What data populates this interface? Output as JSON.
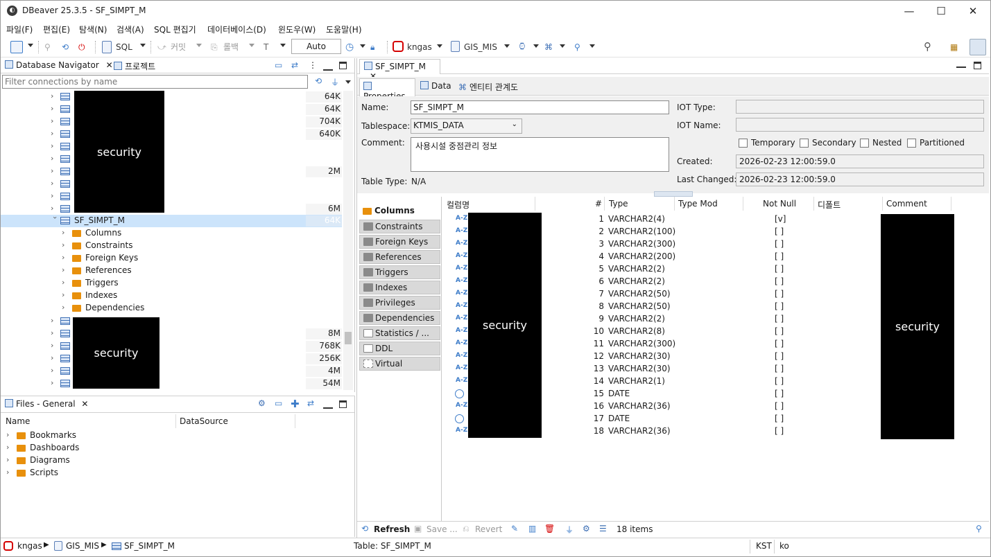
{
  "window": {
    "title": "DBeaver 25.3.5 - SF_SIMPT_M",
    "min": "—",
    "max": "☐",
    "close": "✕"
  },
  "menu": [
    "파일(F)",
    "편집(E)",
    "탐색(N)",
    "검색(A)",
    "SQL 편집기",
    "데이터베이스(D)",
    "윈도우(W)",
    "도움말(H)"
  ],
  "toolbar": {
    "sql": "SQL",
    "commit": "커밋",
    "rollback": "롤백",
    "tx_mode": "Auto",
    "connection": "kngas",
    "schema": "GIS_MIS"
  },
  "navigator": {
    "tab_label": "Database Navigator",
    "tab2_label": "프로젝트",
    "filter_placeholder": "Filter connections by name",
    "sizes_top": [
      "64K",
      "64K",
      "704K",
      "640K",
      "",
      "",
      "2M",
      "",
      "",
      "6M"
    ],
    "selected_table": "SF_SIMPT_M",
    "selected_size": "64K",
    "children": [
      "Columns",
      "Constraints",
      "Foreign Keys",
      "References",
      "Triggers",
      "Indexes",
      "Dependencies"
    ],
    "sizes_bottom": [
      "",
      "8M",
      "768K",
      "256K",
      "4M",
      "54M"
    ],
    "redacted": "security"
  },
  "files": {
    "tab_label": "Files - General",
    "col_name": "Name",
    "col_datasource": "DataSource",
    "items": [
      "Bookmarks",
      "Dashboards",
      "Diagrams",
      "Scripts"
    ]
  },
  "editor": {
    "tab_label": "SF_SIMPT_M",
    "subtabs": [
      "Properties",
      "Data",
      "엔티티 관계도"
    ],
    "props": {
      "name_label": "Name:",
      "name_value": "SF_SIMPT_M",
      "tablespace_label": "Tablespace:",
      "tablespace_value": "KTMIS_DATA",
      "comment_label": "Comment:",
      "comment_value": "사용시설 중점관리 정보",
      "tabletype_label": "Table Type:",
      "tabletype_value": "N/A",
      "iot_type_label": "IOT Type:",
      "iot_name_label": "IOT Name:",
      "checks": [
        "Temporary",
        "Secondary",
        "Nested",
        "Partitioned"
      ],
      "created_label": "Created:",
      "created_value": "2026-02-23 12:00:59.0",
      "changed_label": "Last Changed:",
      "changed_value": "2026-02-23 12:00:59.0"
    },
    "side_tabs": [
      "Columns",
      "Constraints",
      "Foreign Keys",
      "References",
      "Triggers",
      "Indexes",
      "Privileges",
      "Dependencies",
      "Statistics / ...",
      "DDL",
      "Virtual"
    ],
    "grid_headers": [
      "컬럼명",
      "#",
      "Type",
      "Type Mod",
      "Not Null",
      "디폴트",
      "Comment"
    ],
    "rows": [
      {
        "n": "1",
        "type": "VARCHAR2(4)",
        "nn": "[v]",
        "icon": "az"
      },
      {
        "n": "2",
        "type": "VARCHAR2(100)",
        "nn": "[ ]",
        "icon": "az"
      },
      {
        "n": "3",
        "type": "VARCHAR2(300)",
        "nn": "[ ]",
        "icon": "az"
      },
      {
        "n": "4",
        "type": "VARCHAR2(200)",
        "nn": "[ ]",
        "icon": "az"
      },
      {
        "n": "5",
        "type": "VARCHAR2(2)",
        "nn": "[ ]",
        "icon": "az"
      },
      {
        "n": "6",
        "type": "VARCHAR2(2)",
        "nn": "[ ]",
        "icon": "az"
      },
      {
        "n": "7",
        "type": "VARCHAR2(50)",
        "nn": "[ ]",
        "icon": "az"
      },
      {
        "n": "8",
        "type": "VARCHAR2(50)",
        "nn": "[ ]",
        "icon": "az"
      },
      {
        "n": "9",
        "type": "VARCHAR2(2)",
        "nn": "[ ]",
        "icon": "az"
      },
      {
        "n": "10",
        "type": "VARCHAR2(8)",
        "nn": "[ ]",
        "icon": "az"
      },
      {
        "n": "11",
        "type": "VARCHAR2(300)",
        "nn": "[ ]",
        "icon": "az"
      },
      {
        "n": "12",
        "type": "VARCHAR2(30)",
        "nn": "[ ]",
        "icon": "az"
      },
      {
        "n": "13",
        "type": "VARCHAR2(30)",
        "nn": "[ ]",
        "icon": "az"
      },
      {
        "n": "14",
        "type": "VARCHAR2(1)",
        "nn": "[ ]",
        "icon": "az"
      },
      {
        "n": "15",
        "type": "DATE",
        "nn": "[ ]",
        "icon": "clock"
      },
      {
        "n": "16",
        "type": "VARCHAR2(36)",
        "nn": "[ ]",
        "icon": "az"
      },
      {
        "n": "17",
        "type": "DATE",
        "nn": "[ ]",
        "icon": "clock"
      },
      {
        "n": "18",
        "type": "VARCHAR2(36)",
        "nn": "[ ]",
        "icon": "az"
      }
    ],
    "az_text": "A-Z",
    "bottom": {
      "refresh": "Refresh",
      "save": "Save ...",
      "revert": "Revert",
      "items": "18 items"
    }
  },
  "status": {
    "path": [
      "kngas",
      "GIS_MIS",
      "SF_SIMPT_M"
    ],
    "table": "Table: SF_SIMPT_M",
    "tz": "KST",
    "locale": "ko"
  }
}
